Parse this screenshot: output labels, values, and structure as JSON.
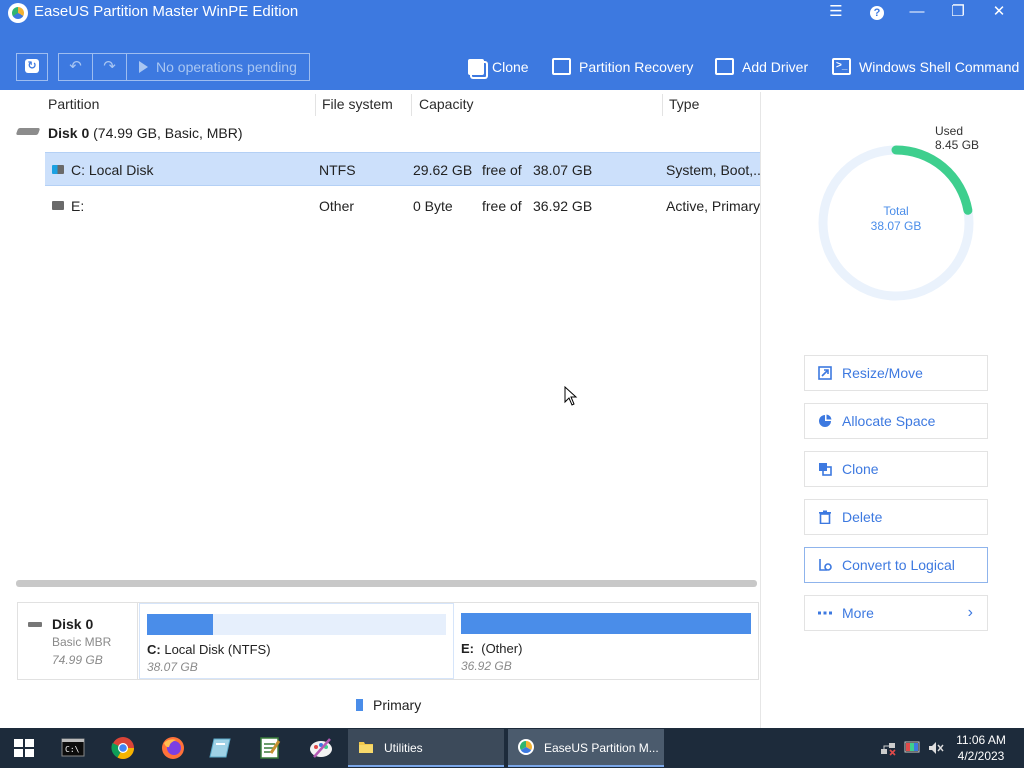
{
  "window": {
    "title": "EaseUS Partition Master WinPE Edition"
  },
  "toolbar": {
    "pending_label": "No operations pending",
    "clone_label": "Clone",
    "recovery_label": "Partition Recovery",
    "driver_label": "Add Driver",
    "shell_label": "Windows Shell Command"
  },
  "table": {
    "headers": {
      "partition": "Partition",
      "filesystem": "File system",
      "capacity": "Capacity",
      "type": "Type"
    },
    "disk": {
      "name": "Disk 0",
      "detail": "(74.99 GB, Basic, MBR)"
    },
    "rows": [
      {
        "name": "C: Local Disk",
        "fs": "NTFS",
        "free": "29.62 GB",
        "of": "free of",
        "total": "38.07 GB",
        "type": "System, Boot,..."
      },
      {
        "name": "E:",
        "fs": "Other",
        "free": "0 Byte",
        "of": "free of",
        "total": "36.92 GB",
        "type": "Active, Primary"
      }
    ]
  },
  "diskmap": {
    "disk_name": "Disk 0",
    "disk_type": "Basic MBR",
    "disk_size": "74.99 GB",
    "partitions": [
      {
        "label": "C:",
        "name": "Local Disk (NTFS)",
        "size": "38.07 GB",
        "used_fraction": 0.22
      },
      {
        "label": "E:",
        "name": "(Other)",
        "size": "36.92 GB",
        "used_fraction": 1.0
      }
    ],
    "legend": "Primary"
  },
  "usage": {
    "used_label": "Used",
    "used_value": "8.45 GB",
    "total_label": "Total",
    "total_value": "38.07 GB",
    "used_fraction": 0.222
  },
  "actions": {
    "resize": "Resize/Move",
    "allocate": "Allocate Space",
    "clone": "Clone",
    "delete": "Delete",
    "convert": "Convert to Logical",
    "more": "More"
  },
  "taskbar": {
    "utilities": "Utilities",
    "easeus": "EaseUS Partition M...",
    "time": "11:06 AM",
    "date": "4/2/2023"
  },
  "colors": {
    "accent": "#3d79e0",
    "selected_row": "#cce0fb",
    "used_arc": "#3ecf8e",
    "bar": "#4a8de9"
  }
}
